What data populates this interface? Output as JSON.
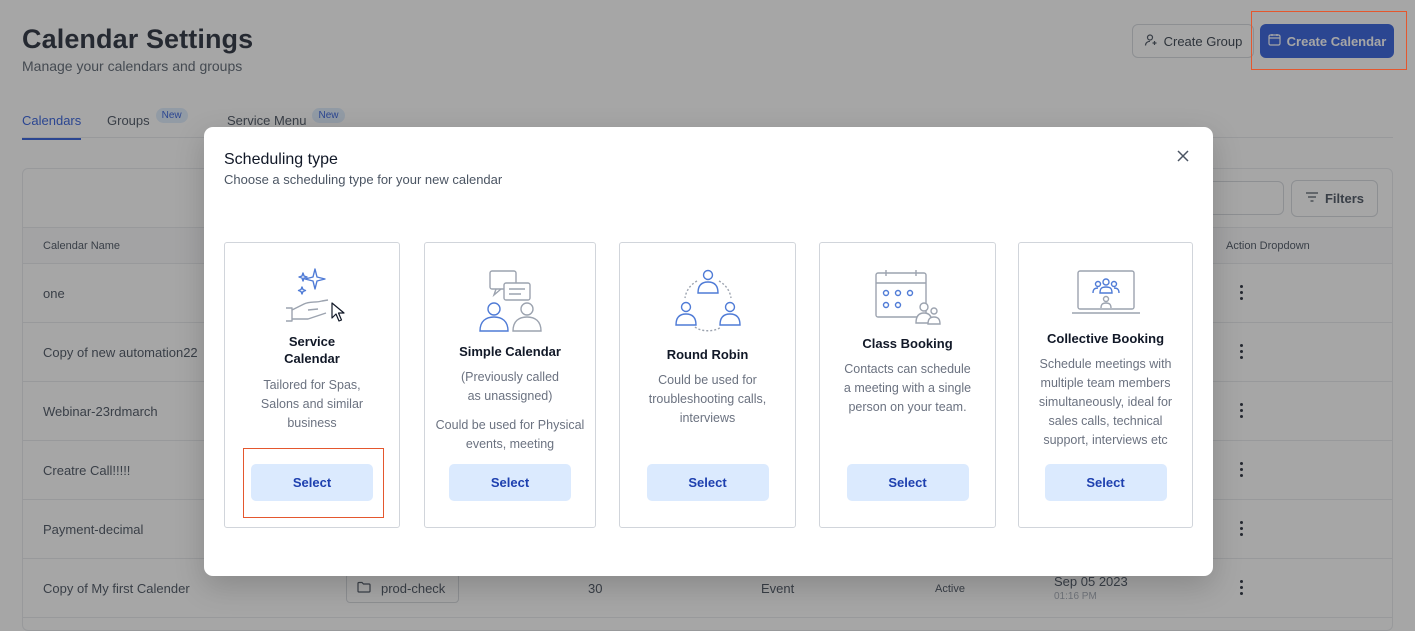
{
  "page": {
    "title": "Calendar Settings",
    "subtitle": "Manage your calendars and groups",
    "create_group_label": "Create Group",
    "create_calendar_label": "Create Calendar",
    "tabs": [
      {
        "label": "Calendars",
        "active": true,
        "badge": ""
      },
      {
        "label": "Groups",
        "active": false,
        "badge": "New"
      },
      {
        "label": "Service Menu",
        "active": false,
        "badge": "New"
      }
    ],
    "filters_label": "Filters",
    "table": {
      "headers": {
        "name": "Calendar Name",
        "action": "Action Dropdown"
      },
      "rows": [
        {
          "name": "one"
        },
        {
          "name": "Copy of new automation22"
        },
        {
          "name": "Webinar-23rdmarch"
        },
        {
          "name": "Creatre Call!!!!!"
        },
        {
          "name": "Payment-decimal"
        },
        {
          "name": "Copy of My first Calender",
          "group": "prod-check",
          "duration": "30",
          "type": "Event",
          "status": "Active",
          "date": "Sep 05 2023",
          "time": "01:16 PM"
        }
      ]
    }
  },
  "modal": {
    "title": "Scheduling type",
    "subtitle": "Choose a scheduling type for your new calendar",
    "cards": [
      {
        "title": "Service\nCalendar",
        "description": "Tailored for Spas,\nSalons and similar\nbusiness",
        "button": "Select",
        "icon": "sparkle-hand-icon"
      },
      {
        "title": "Simple Calendar",
        "description": "(Previously called\nas unassigned)\n\nCould be used for Physical\nevents, meeting",
        "button": "Select",
        "icon": "people-chat-icon"
      },
      {
        "title": "Round Robin",
        "description": "Could be used for\ntroubleshooting calls,\ninterviews",
        "button": "Select",
        "icon": "round-robin-icon"
      },
      {
        "title": "Class Booking",
        "description": "Contacts can schedule\na meeting with a single\nperson on your team.",
        "button": "Select",
        "icon": "calendar-group-icon"
      },
      {
        "title": "Collective Booking",
        "description": "Schedule meetings with\nmultiple team members\nsimultaneously, ideal for\nsales calls, technical\nsupport, interviews etc",
        "button": "Select",
        "icon": "monitor-group-icon"
      }
    ]
  },
  "colors": {
    "primary": "#1d4ed8",
    "select_bg": "#dbeafe",
    "highlight": "#e4572e",
    "icon_blue": "#4f7bd6"
  }
}
